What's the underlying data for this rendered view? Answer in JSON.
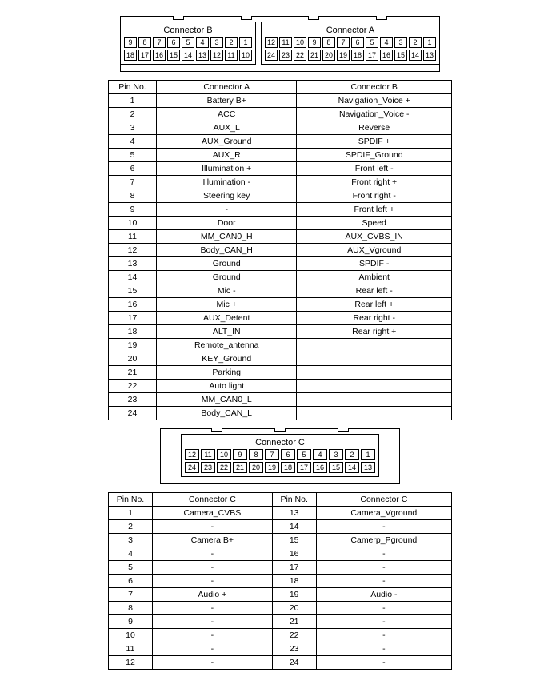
{
  "connectors_top": {
    "left": {
      "title": "Connector B",
      "rows": [
        [
          "9",
          "8",
          "7",
          "6",
          "5",
          "4",
          "3",
          "2",
          "1"
        ],
        [
          "18",
          "17",
          "16",
          "15",
          "14",
          "13",
          "12",
          "11",
          "10"
        ]
      ]
    },
    "right": {
      "title": "Connector A",
      "rows": [
        [
          "12",
          "11",
          "10",
          "9",
          "8",
          "7",
          "6",
          "5",
          "4",
          "3",
          "2",
          "1"
        ],
        [
          "24",
          "23",
          "22",
          "21",
          "20",
          "19",
          "18",
          "17",
          "16",
          "15",
          "14",
          "13"
        ]
      ]
    }
  },
  "table_ab": {
    "headers": [
      "Pin No.",
      "Connector A",
      "Connector B"
    ],
    "rows": [
      [
        "1",
        "Battery B+",
        "Navigation_Voice +"
      ],
      [
        "2",
        "ACC",
        "Navigation_Voice -"
      ],
      [
        "3",
        "AUX_L",
        "Reverse"
      ],
      [
        "4",
        "AUX_Ground",
        "SPDIF +"
      ],
      [
        "5",
        "AUX_R",
        "SPDIF_Ground"
      ],
      [
        "6",
        "Illumination +",
        "Front left -"
      ],
      [
        "7",
        "Illumination -",
        "Front right +"
      ],
      [
        "8",
        "Steering key",
        "Front right -"
      ],
      [
        "9",
        "-",
        "Front left +"
      ],
      [
        "10",
        "Door",
        "Speed"
      ],
      [
        "11",
        "MM_CAN0_H",
        "AUX_CVBS_IN"
      ],
      [
        "12",
        "Body_CAN_H",
        "AUX_Vground"
      ],
      [
        "13",
        "Ground",
        "SPDIF -"
      ],
      [
        "14",
        "Ground",
        "Ambient"
      ],
      [
        "15",
        "Mic -",
        "Rear left -"
      ],
      [
        "16",
        "Mic +",
        "Rear left +"
      ],
      [
        "17",
        "AUX_Detent",
        "Rear right -"
      ],
      [
        "18",
        "ALT_IN",
        "Rear right +"
      ],
      [
        "19",
        "Remote_antenna",
        ""
      ],
      [
        "20",
        "KEY_Ground",
        ""
      ],
      [
        "21",
        "Parking",
        ""
      ],
      [
        "22",
        "Auto light",
        ""
      ],
      [
        "23",
        "MM_CAN0_L",
        ""
      ],
      [
        "24",
        "Body_CAN_L",
        ""
      ]
    ]
  },
  "connector_c": {
    "title": "Connector C",
    "rows": [
      [
        "12",
        "11",
        "10",
        "9",
        "8",
        "7",
        "6",
        "5",
        "4",
        "3",
        "2",
        "1"
      ],
      [
        "24",
        "23",
        "22",
        "21",
        "20",
        "19",
        "18",
        "17",
        "16",
        "15",
        "14",
        "13"
      ]
    ]
  },
  "table_c": {
    "headers": [
      "Pin No.",
      "Connector C",
      "Pin No.",
      "Connector C"
    ],
    "rows": [
      [
        "1",
        "Camera_CVBS",
        "13",
        "Camera_Vground"
      ],
      [
        "2",
        "-",
        "14",
        "-"
      ],
      [
        "3",
        "Camera B+",
        "15",
        "Camerp_Pground"
      ],
      [
        "4",
        "-",
        "16",
        "-"
      ],
      [
        "5",
        "-",
        "17",
        "-"
      ],
      [
        "6",
        "-",
        "18",
        "-"
      ],
      [
        "7",
        "Audio +",
        "19",
        "Audio -"
      ],
      [
        "8",
        "-",
        "20",
        "-"
      ],
      [
        "9",
        "-",
        "21",
        "-"
      ],
      [
        "10",
        "-",
        "22",
        "-"
      ],
      [
        "11",
        "-",
        "23",
        "-"
      ],
      [
        "12",
        "-",
        "24",
        "-"
      ]
    ]
  }
}
